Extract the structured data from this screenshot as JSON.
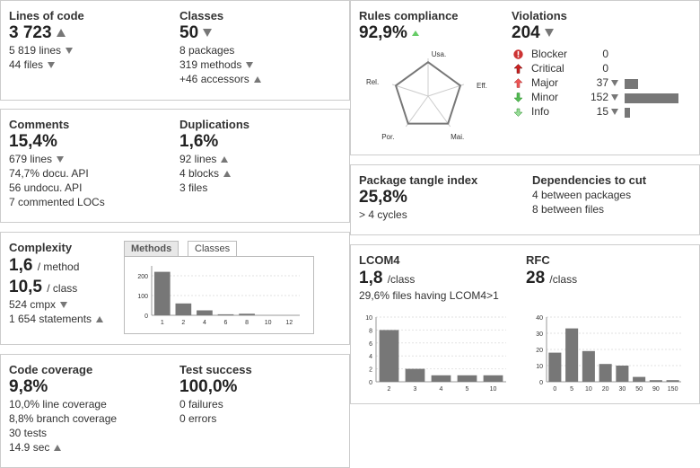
{
  "lines_of_code": {
    "title": "Lines of code",
    "value": "3 723",
    "lines": "5 819 lines",
    "files": "44 files"
  },
  "classes": {
    "title": "Classes",
    "value": "50",
    "packages": "8 packages",
    "methods": "319 methods",
    "accessors": "+46 accessors"
  },
  "comments": {
    "title": "Comments",
    "value": "15,4%",
    "lines": "679 lines",
    "docu_api": "74,7% docu. API",
    "undocu_api": "56 undocu. API",
    "commented_locs": "7 commented LOCs"
  },
  "duplications": {
    "title": "Duplications",
    "value": "1,6%",
    "lines": "92 lines",
    "blocks": "4 blocks",
    "files": "3 files"
  },
  "complexity": {
    "title": "Complexity",
    "per_method_value": "1,6",
    "per_method_unit": "/ method",
    "per_class_value": "10,5",
    "per_class_unit": "/ class",
    "cmpx": "524 cmpx",
    "statements": "1 654 statements",
    "tabs": [
      "Methods",
      "Classes"
    ]
  },
  "coverage": {
    "title": "Code coverage",
    "value": "9,8%",
    "line_coverage": "10,0% line coverage",
    "branch_coverage": "8,8% branch coverage",
    "tests": "30 tests",
    "time": "14.9 sec"
  },
  "test_success": {
    "title": "Test success",
    "value": "100,0%",
    "failures": "0 failures",
    "errors": "0 errors"
  },
  "rules": {
    "title": "Rules compliance",
    "value": "92,9%",
    "radar_labels": [
      "Usa.",
      "Eff.",
      "Mai.",
      "Por.",
      "Rel."
    ]
  },
  "violations": {
    "title": "Violations",
    "value": "204",
    "rows": [
      {
        "label": "Blocker",
        "count": "0",
        "icon": "blocker-icon",
        "bar": 0
      },
      {
        "label": "Critical",
        "count": "0",
        "icon": "critical-icon",
        "bar": 0
      },
      {
        "label": "Major",
        "count": "37",
        "icon": "major-icon",
        "bar": 37
      },
      {
        "label": "Minor",
        "count": "152",
        "icon": "minor-icon",
        "bar": 152
      },
      {
        "label": "Info",
        "count": "15",
        "icon": "info-icon",
        "bar": 15
      }
    ]
  },
  "tangle": {
    "title": "Package tangle index",
    "value": "25,8%",
    "cycles": "> 4 cycles"
  },
  "dependencies": {
    "title": "Dependencies to cut",
    "packages": "4 between packages",
    "files": "8 between files"
  },
  "lcom4": {
    "title": "LCOM4",
    "value": "1,8",
    "unit": "/class",
    "note": "29,6% files having LCOM4>1"
  },
  "rfc": {
    "title": "RFC",
    "value": "28",
    "unit": "/class"
  },
  "chart_data": [
    {
      "type": "bar",
      "name": "complexity-methods",
      "categories": [
        "1",
        "2",
        "4",
        "6",
        "8",
        "10",
        "12"
      ],
      "values": [
        220,
        60,
        25,
        5,
        8,
        0,
        0
      ],
      "ylim": [
        0,
        250
      ],
      "yticks": [
        "0",
        "100",
        "200"
      ]
    },
    {
      "type": "bar",
      "name": "lcom4",
      "categories": [
        "2",
        "3",
        "4",
        "5",
        "10"
      ],
      "values": [
        8,
        2,
        1,
        1,
        1
      ],
      "ylim": [
        0,
        10
      ],
      "yticks": [
        "0",
        "2",
        "4",
        "6",
        "8",
        "10"
      ]
    },
    {
      "type": "bar",
      "name": "rfc",
      "categories": [
        "0",
        "5",
        "10",
        "20",
        "30",
        "50",
        "90",
        "150"
      ],
      "values": [
        18,
        33,
        19,
        11,
        10,
        3,
        1,
        1
      ],
      "ylim": [
        0,
        40
      ],
      "yticks": [
        "0",
        "10",
        "20",
        "30",
        "40"
      ]
    },
    {
      "type": "radar",
      "name": "rules-compliance",
      "categories": [
        "Usa.",
        "Eff.",
        "Mai.",
        "Por.",
        "Rel."
      ],
      "values": [
        0.9,
        0.9,
        0.9,
        0.9,
        0.9
      ],
      "ylim": [
        0,
        1
      ]
    }
  ]
}
